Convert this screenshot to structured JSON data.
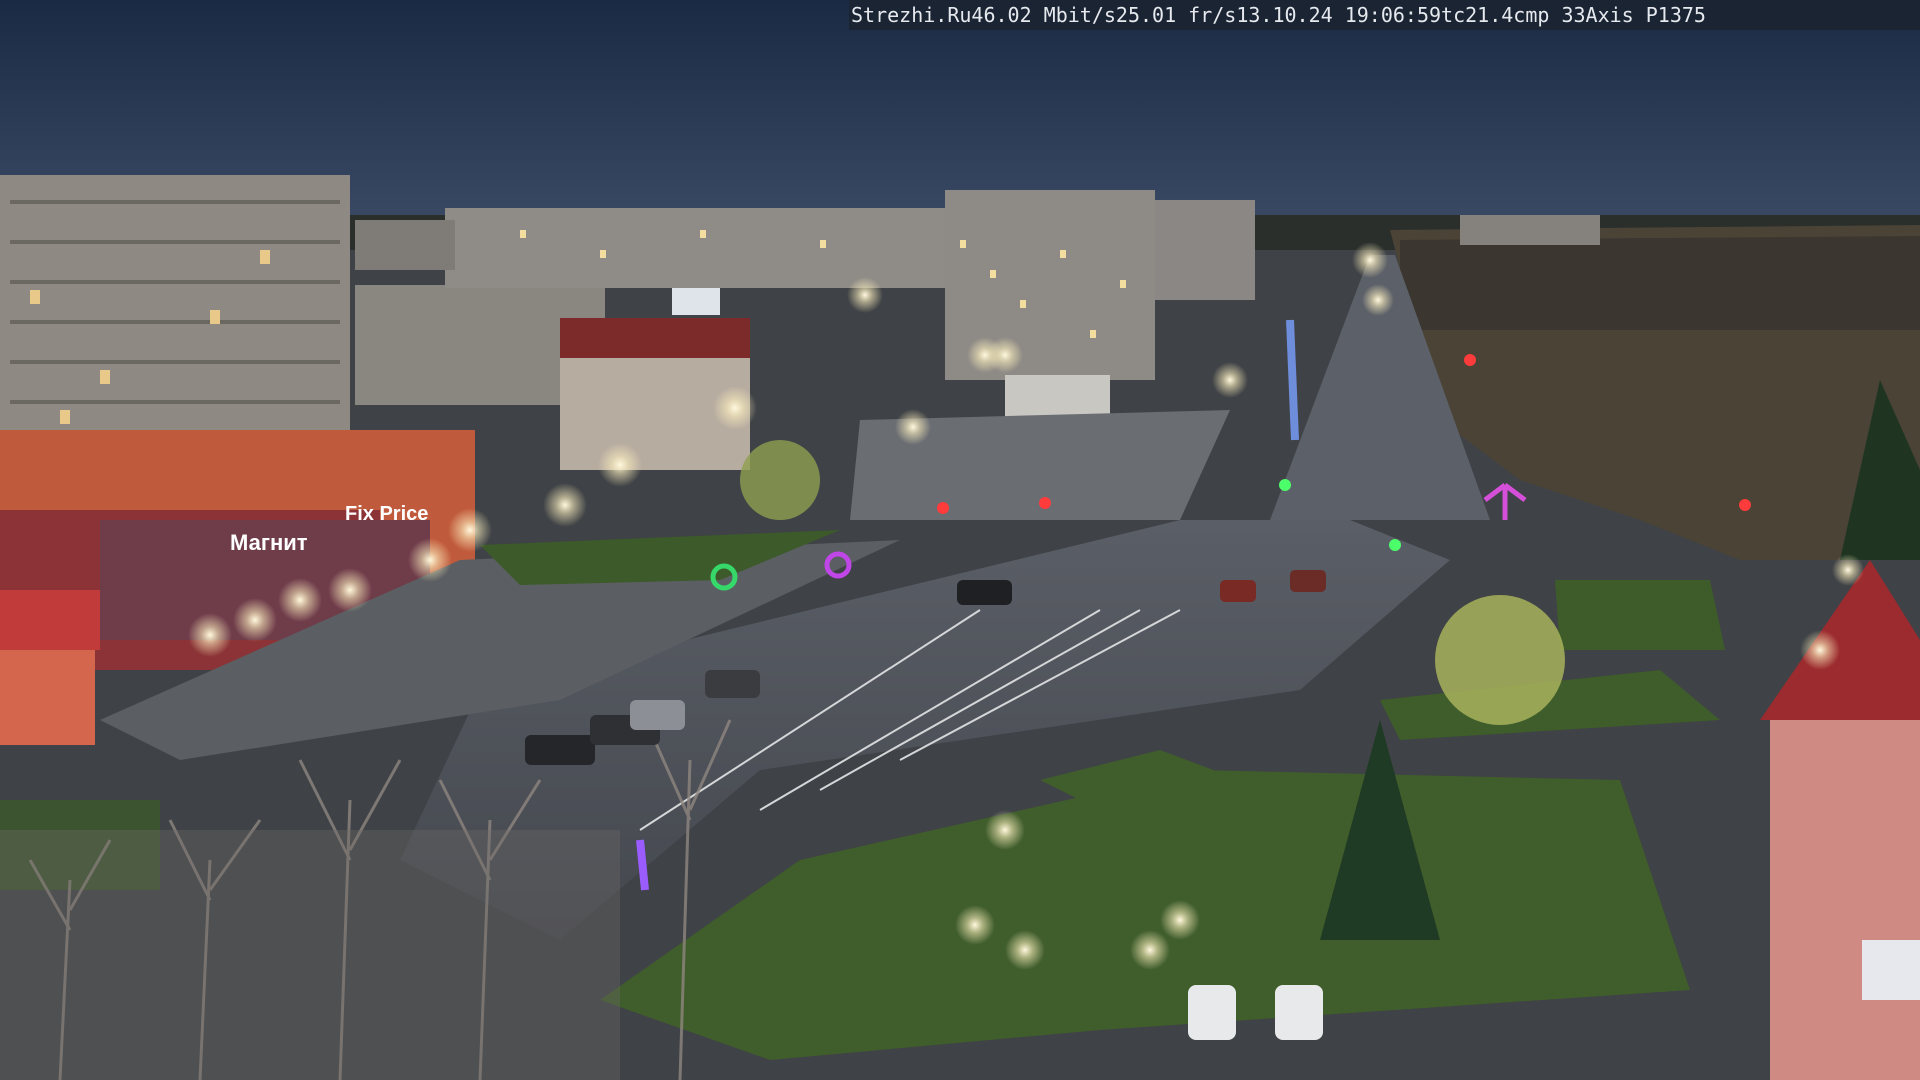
{
  "camera_overlay": {
    "site": "Strezhi.Ru",
    "bitrate": "46.02 Mbit/s",
    "framerate": "25.01 fr/s",
    "datetime": "13.10.24 19:06:59",
    "tc": "tc21.4",
    "cmp": "cmp 33",
    "model": "Axis P1375"
  },
  "scene": {
    "description_colors": {
      "sky_top": "#1d2b44",
      "sky_bottom": "#3a4a66",
      "road": "#4e525a",
      "grass": "#3d5a2c",
      "building": "#8f8a82",
      "lamp_glow": "#fff6d8"
    },
    "signs": [
      "Магнит",
      "Fix Price"
    ]
  }
}
